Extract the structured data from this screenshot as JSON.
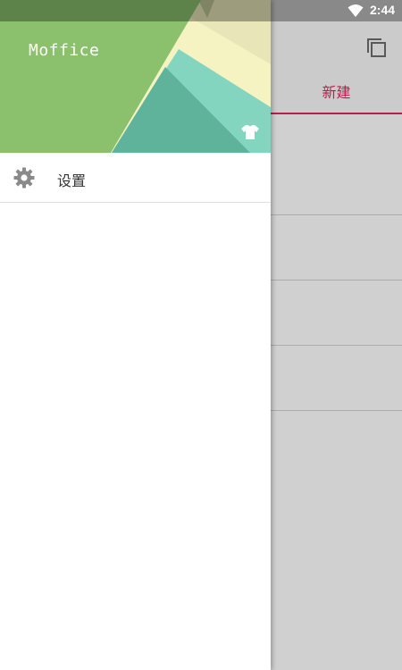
{
  "status_bar": {
    "time": "2:44",
    "wifi_icon": "wifi-icon"
  },
  "app": {
    "toolbar": {
      "copy_icon": "copy-icon"
    },
    "tabs": [
      {
        "label": "新建",
        "selected": true
      }
    ],
    "accent_color": "#e0245e"
  },
  "drawer": {
    "header": {
      "title": "Moffice",
      "theme_icon": "shirt-icon"
    },
    "items": [
      {
        "label": "设置",
        "icon": "gear-icon"
      }
    ]
  }
}
